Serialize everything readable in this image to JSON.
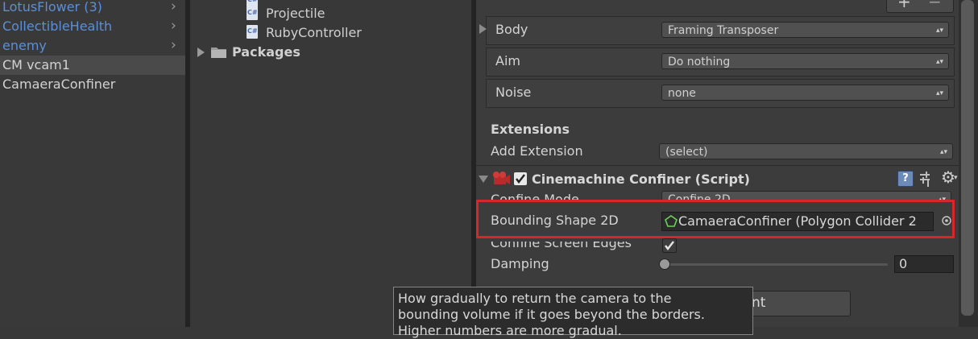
{
  "hierarchy": {
    "items": [
      {
        "label": "LotusFlower (3)",
        "prefab": true
      },
      {
        "label": "CollectibleHealth",
        "prefab": true
      },
      {
        "label": "enemy",
        "prefab": true
      },
      {
        "label": "CM vcam1",
        "prefab": false,
        "selected": true
      },
      {
        "label": "CamaeraConfiner",
        "prefab": false
      }
    ]
  },
  "project": {
    "files": [
      {
        "label": "Projectile",
        "icon": "csharp-script-icon"
      },
      {
        "label": "RubyController",
        "icon": "csharp-script-icon"
      }
    ],
    "folder": {
      "label": "Packages",
      "icon": "folder-icon"
    }
  },
  "inspector": {
    "pipeline": [
      {
        "label": "Body",
        "value": "Framing Transposer"
      },
      {
        "label": "Aim",
        "value": "Do nothing"
      },
      {
        "label": "Noise",
        "value": "none"
      }
    ],
    "extensions_heading": "Extensions",
    "add_extension_label": "Add Extension",
    "add_extension_value": "(select)",
    "component_title": "Cinemachine Confiner (Script)",
    "confine_mode_label": "Confine Mode",
    "confine_mode_value": "Confine 2D",
    "bounding_label": "Bounding Shape 2D",
    "bounding_value": "CamaeraConfiner (Polygon Collider 2",
    "confine_edges_label": "Confine Screen Edges",
    "confine_edges_checked": true,
    "damping_label": "Damping",
    "damping_value": "0",
    "button_partial": "nt",
    "plus": "+",
    "minus": "−"
  },
  "tooltip": {
    "line1": "How gradually to return the camera to the",
    "line2": "bounding volume if it goes beyond the borders.",
    "line3": "Higher numbers are more gradual."
  },
  "colors": {
    "highlight": "#d9262b",
    "prefab_text": "#5c8fd6"
  }
}
